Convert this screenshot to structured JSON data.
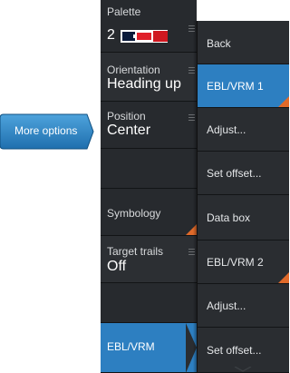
{
  "more_options": {
    "label": "More options"
  },
  "panel": {
    "palette": {
      "label": "Palette",
      "value": "2"
    },
    "orientation": {
      "label": "Orientation",
      "value": "Heading up"
    },
    "position": {
      "label": "Position",
      "value": "Center"
    },
    "symbology": {
      "label": "Symbology"
    },
    "target_trails": {
      "label": "Target trails",
      "value": "Off"
    },
    "ebl_vrm": {
      "label": "EBL/VRM"
    }
  },
  "submenu": {
    "items": [
      {
        "label": "Back"
      },
      {
        "label": "EBL/VRM 1"
      },
      {
        "label": "Adjust..."
      },
      {
        "label": "Set offset..."
      },
      {
        "label": "Data box"
      },
      {
        "label": "EBL/VRM 2"
      },
      {
        "label": "Adjust..."
      },
      {
        "label": "Set offset..."
      }
    ]
  },
  "colors": {
    "accent_blue": "#2d7fc1",
    "accent_orange": "#e06a2a",
    "panel_bg": "#272a2e"
  }
}
